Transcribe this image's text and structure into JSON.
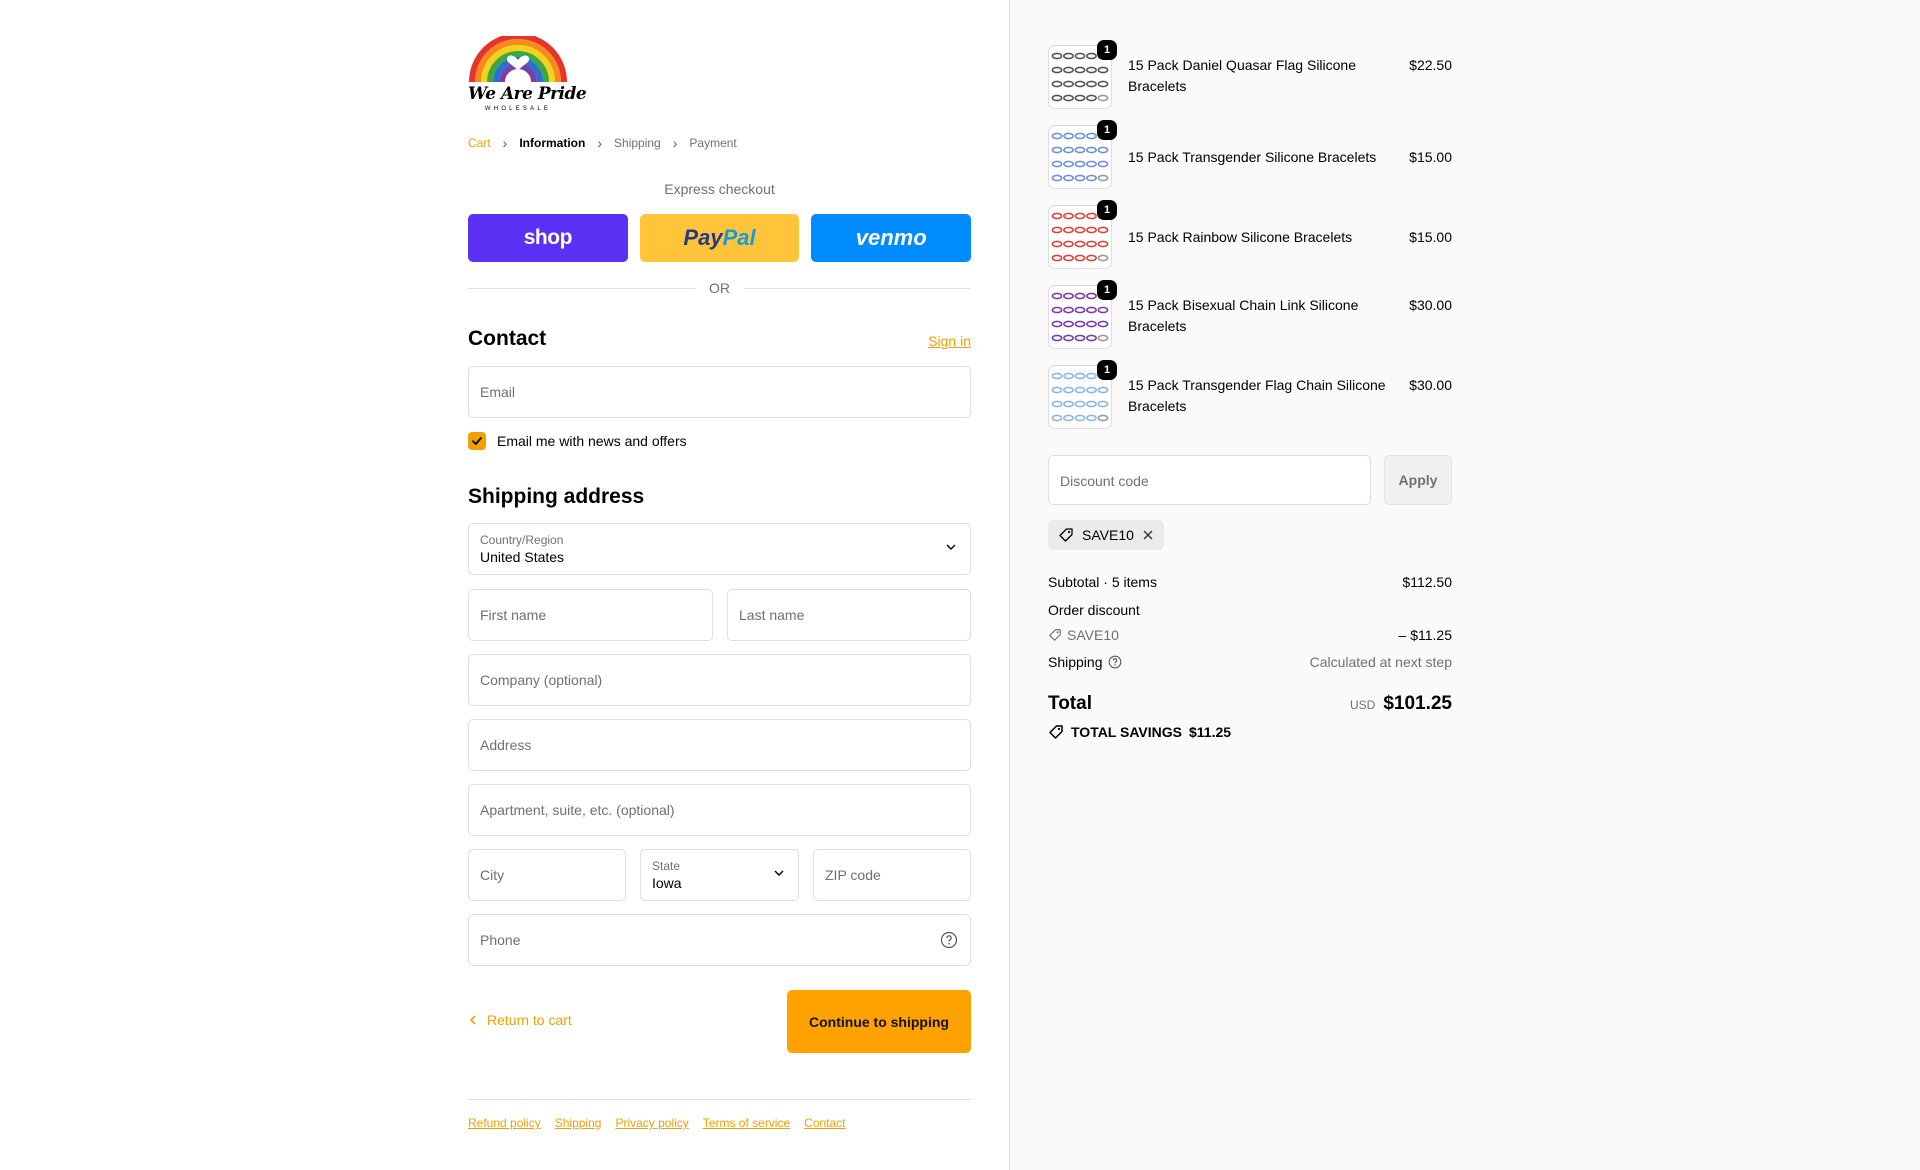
{
  "brand": {
    "logo_text": "We Are Pride",
    "logo_sub": "WHOLESALE"
  },
  "breadcrumb": {
    "cart": "Cart",
    "information": "Information",
    "shipping": "Shipping",
    "payment": "Payment"
  },
  "express": {
    "title": "Express checkout",
    "shop": "shop",
    "paypal_a": "Pay",
    "paypal_b": "Pal",
    "venmo": "venmo",
    "or": "OR"
  },
  "contact": {
    "heading": "Contact",
    "sign_in": "Sign in",
    "email_placeholder": "Email",
    "newsletter_label": "Email me with news and offers",
    "newsletter_checked": true
  },
  "shipping": {
    "heading": "Shipping address",
    "country_label": "Country/Region",
    "country_value": "United States",
    "first_name": "First name",
    "last_name": "Last name",
    "company": "Company (optional)",
    "address": "Address",
    "apartment": "Apartment, suite, etc. (optional)",
    "city": "City",
    "state_label": "State",
    "state_value": "Iowa",
    "zip": "ZIP code",
    "phone": "Phone"
  },
  "actions": {
    "return": "Return to cart",
    "continue": "Continue to shipping"
  },
  "footer": [
    "Refund policy",
    "Shipping",
    "Privacy policy",
    "Terms of service",
    "Contact"
  ],
  "items": [
    {
      "qty": "1",
      "name": "15 Pack Daniel Quasar Flag Silicone Bracelets",
      "price": "$22.50",
      "color": "#555555"
    },
    {
      "qty": "1",
      "name": "15 Pack Transgender Silicone Bracelets",
      "price": "$15.00",
      "color": "#6f8fd6"
    },
    {
      "qty": "1",
      "name": "15 Pack Rainbow Silicone Bracelets",
      "price": "$15.00",
      "color": "#d9433b"
    },
    {
      "qty": "1",
      "name": "15 Pack Bisexual Chain Link Silicone Bracelets",
      "price": "$30.00",
      "color": "#7a3fa8"
    },
    {
      "qty": "1",
      "name": "15 Pack Transgender Flag Chain Silicone Bracelets",
      "price": "$30.00",
      "color": "#8ab6e6"
    }
  ],
  "discount": {
    "placeholder": "Discount code",
    "apply": "Apply",
    "code": "SAVE10"
  },
  "totals": {
    "subtotal_label": "Subtotal · 5 items",
    "subtotal": "$112.50",
    "order_discount_label": "Order discount",
    "discount_code": "SAVE10",
    "discount_amount": "– $11.25",
    "shipping_label": "Shipping",
    "shipping_value": "Calculated at next step",
    "total_label": "Total",
    "currency": "USD",
    "total": "$101.25",
    "savings_label": "TOTAL SAVINGS",
    "savings": "$11.25"
  },
  "colors": {
    "accent": "#f2a000",
    "shop": "#5a31f4",
    "paypal": "#ffc439",
    "venmo": "#008cff"
  }
}
